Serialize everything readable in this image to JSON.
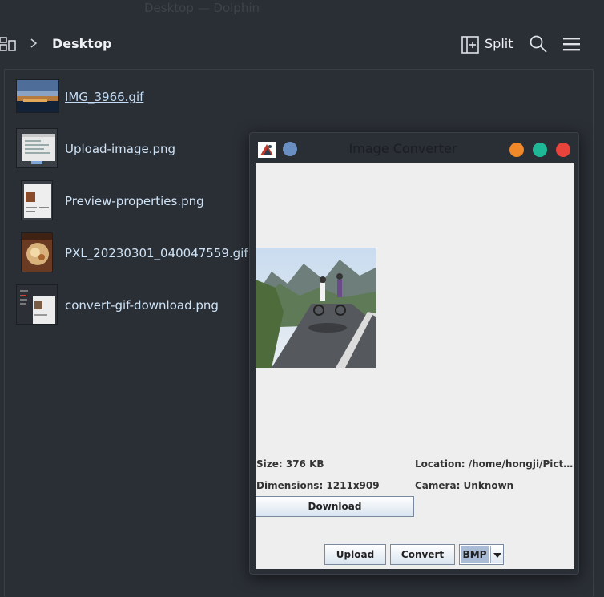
{
  "window": {
    "title": "Desktop — Dolphin"
  },
  "toolbar": {
    "breadcrumb": "Desktop",
    "split_label": "Split",
    "icons": [
      "places-icon",
      "chevron-right-icon",
      "split-view-icon",
      "search-icon",
      "hamburger-menu-icon"
    ]
  },
  "files": [
    {
      "name": "IMG_3966.gif"
    },
    {
      "name": "Upload-image.png"
    },
    {
      "name": "Preview-properties.png"
    },
    {
      "name": "PXL_20230301_040047559.gif"
    },
    {
      "name": "convert-gif-download.png"
    }
  ],
  "dialog": {
    "title": "Image Converter",
    "size": "Size: 376 KB",
    "location": "Location: /home/hongji/Picture...",
    "dimensions": "Dimensions: 1211x909",
    "camera": "Camera: Unknown",
    "download_label": "Download",
    "upload_label": "Upload",
    "convert_label": "Convert",
    "format_selected": "BMP"
  },
  "colors": {
    "background": "#2a2e35",
    "file_text": "#cfe3f6",
    "minimize": "#f1882a",
    "maximize": "#1fb897",
    "close": "#e9443b",
    "pin": "#6a8fc2"
  }
}
